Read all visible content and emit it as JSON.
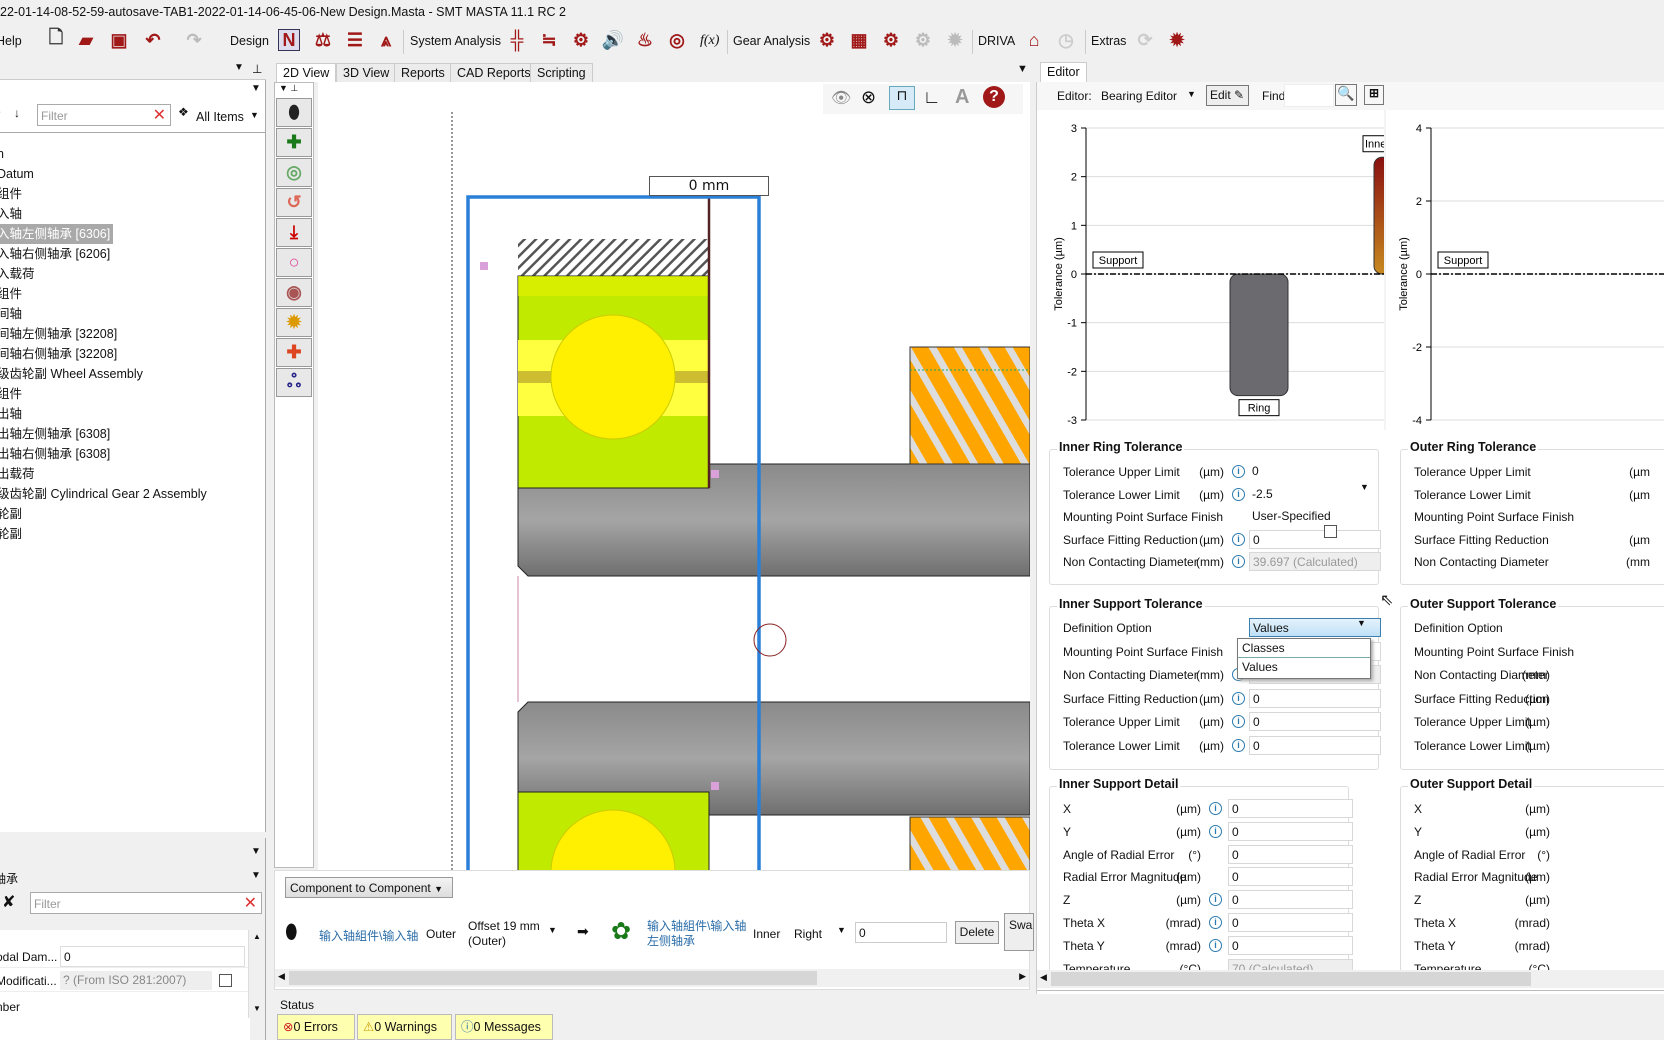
{
  "window": {
    "title": "22-01-14-08-52-59-autosave-TAB1-2022-01-14-06-45-06-New Design.Masta - SMT MASTA 11.1 RC 2"
  },
  "toolbar": {
    "help": "Help",
    "design": "Design",
    "system_analysis": "System Analysis",
    "fx": "f(x)",
    "gear_analysis": "Gear Analysis",
    "driva": "DRIVA",
    "extras": "Extras",
    "accent": "#a01818"
  },
  "tree_panel": {
    "filter_placeholder": "Filter",
    "all_items": "All Items",
    "items": [
      {
        "label": "n"
      },
      {
        "label": " Datum"
      },
      {
        "label": "组件"
      },
      {
        "label": "入轴"
      },
      {
        "label": "入轴左侧轴承 [6306]",
        "selected": true
      },
      {
        "label": "入轴右侧轴承 [6206]"
      },
      {
        "label": "入载荷"
      },
      {
        "label": "组件"
      },
      {
        "label": "间轴"
      },
      {
        "label": "间轴左侧轴承 [32208]"
      },
      {
        "label": "间轴右侧轴承 [32208]"
      },
      {
        "label": "级齿轮副 Wheel Assembly"
      },
      {
        "label": "组件"
      },
      {
        "label": "出轴"
      },
      {
        "label": "出轴左侧轴承 [6308]"
      },
      {
        "label": "出轴右侧轴承 [6308]"
      },
      {
        "label": "出载荷"
      },
      {
        "label": "级齿轮副 Cylindrical Gear 2 Assembly"
      },
      {
        "label": "轮副"
      },
      {
        "label": "轮副"
      }
    ]
  },
  "property_panel": {
    "selector": "轴承",
    "filter_placeholder": "Filter",
    "rows": [
      {
        "label": "odal Dam...",
        "value": "0"
      },
      {
        "label": "Modificati...",
        "value": "? (From ISO 281:2007)"
      },
      {
        "label": "nber",
        "value": ""
      }
    ]
  },
  "view_tabs": [
    "2D View",
    "3D View",
    "Reports",
    "CAD Reports",
    "Scripting"
  ],
  "view": {
    "dimension_label": "0 mm"
  },
  "connection": {
    "mode": "Component to Component",
    "from": "输入轴組件\\输入轴",
    "from_side": "Outer",
    "offset": "Offset 19 mm",
    "offset_sub": "(Outer)",
    "to": "输入轴組件\\输入轴左侧轴承",
    "to_side": "Inner",
    "position": "Right",
    "value": "0",
    "delete": "Delete",
    "swap": "Swap"
  },
  "status": {
    "title": "Status",
    "errors": "0 Errors",
    "warnings": "0 Warnings",
    "messages": "0 Messages"
  },
  "editor": {
    "tab": "Editor",
    "label": "Editor:",
    "editor_type": "Bearing Editor",
    "edit": "Edit",
    "find": "Find",
    "find_value": ""
  },
  "chart_data": [
    {
      "type": "bar",
      "ylabel": "Tolerance (µm)",
      "ylim": [
        -3,
        3
      ],
      "yticks": [
        -3,
        -2,
        -1,
        0,
        1,
        2,
        3
      ],
      "grid": true,
      "annotations": [
        "Support",
        "Ring",
        "Inner"
      ],
      "series": [
        {
          "name": "Ring",
          "values": [
            [
              -2.5,
              0
            ]
          ],
          "color": "#6b6a6e"
        },
        {
          "name": "Inner",
          "values": [
            [
              0,
              2.4
            ]
          ],
          "color": "#b03010"
        }
      ]
    },
    {
      "type": "bar",
      "ylabel": "Tolerance (µm)",
      "ylim": [
        -4,
        4
      ],
      "yticks": [
        -4,
        -2,
        0,
        2,
        4
      ],
      "grid": true,
      "annotations": [
        "Support"
      ],
      "series": []
    }
  ],
  "inner_ring_tolerance": {
    "title": "Inner Ring Tolerance",
    "rows": [
      {
        "label": "Tolerance Upper Limit",
        "unit": "(µm)",
        "value": "0"
      },
      {
        "label": "Tolerance Lower Limit",
        "unit": "(µm)",
        "value": "-2.5"
      },
      {
        "label": "Mounting Point Surface Finish",
        "unit": "",
        "value": "User-Specified"
      },
      {
        "label": "Surface Fitting Reduction",
        "unit": "(µm)",
        "value": "0"
      },
      {
        "label": "Non Contacting Diameter",
        "unit": "(mm)",
        "value": "39.697 (Calculated)"
      }
    ]
  },
  "outer_ring_tolerance": {
    "title": "Outer Ring Tolerance",
    "rows": [
      {
        "label": "Tolerance Upper Limit",
        "unit": "(µm"
      },
      {
        "label": "Tolerance Lower Limit",
        "unit": "(µm"
      },
      {
        "label": "Mounting Point Surface Finish",
        "unit": ""
      },
      {
        "label": "Surface Fitting Reduction",
        "unit": "(µm"
      },
      {
        "label": "Non Contacting Diameter",
        "unit": "(mm"
      }
    ]
  },
  "inner_support_tolerance": {
    "title": "Inner Support Tolerance",
    "rows": [
      {
        "label": "Definition Option",
        "unit": "",
        "value": "Values"
      },
      {
        "label": "Mounting Point Surface Finish",
        "unit": "",
        "value": ""
      },
      {
        "label": "Non Contacting Diameter",
        "unit": "(mm)",
        "value": ""
      },
      {
        "label": "Surface Fitting Reduction",
        "unit": "(µm)",
        "value": "0"
      },
      {
        "label": "Tolerance Upper Limit",
        "unit": "(µm)",
        "value": "0"
      },
      {
        "label": "Tolerance Lower Limit",
        "unit": "(µm)",
        "value": "0"
      }
    ],
    "dropdown_options": [
      "Classes",
      "Values"
    ]
  },
  "outer_support_tolerance": {
    "title": "Outer Support Tolerance",
    "rows": [
      {
        "label": "Definition Option",
        "unit": ""
      },
      {
        "label": "Mounting Point Surface Finish",
        "unit": ""
      },
      {
        "label": "Non Contacting Diameter",
        "unit": "(mm)"
      },
      {
        "label": "Surface Fitting Reduction",
        "unit": "(µm)"
      },
      {
        "label": "Tolerance Upper Limit",
        "unit": "(µm)"
      },
      {
        "label": "Tolerance Lower Limit",
        "unit": "(µm)"
      }
    ]
  },
  "inner_support_detail": {
    "title": "Inner Support Detail",
    "rows": [
      {
        "label": "X",
        "unit": "(µm)",
        "value": "0",
        "info": true
      },
      {
        "label": "Y",
        "unit": "(µm)",
        "value": "0",
        "info": true
      },
      {
        "label": "Angle of Radial Error",
        "unit": "(°)",
        "value": "0",
        "info": false
      },
      {
        "label": "Radial Error Magnitude",
        "unit": "(µm)",
        "value": "0",
        "info": false
      },
      {
        "label": "Z",
        "unit": "(µm)",
        "value": "0",
        "info": true
      },
      {
        "label": "Theta X",
        "unit": "(mrad)",
        "value": "0",
        "info": true
      },
      {
        "label": "Theta Y",
        "unit": "(mrad)",
        "value": "0",
        "info": true
      },
      {
        "label": "Temperature",
        "unit": "(°C)",
        "value": "70 (Calculated)",
        "info": false
      }
    ]
  },
  "outer_support_detail": {
    "title": "Outer Support Detail",
    "rows": [
      {
        "label": "X",
        "unit": "(µm)"
      },
      {
        "label": "Y",
        "unit": "(µm)"
      },
      {
        "label": "Angle of Radial Error",
        "unit": "(°)"
      },
      {
        "label": "Radial Error Magnitude",
        "unit": "(µm)"
      },
      {
        "label": "Z",
        "unit": "(µm)"
      },
      {
        "label": "Theta X",
        "unit": "(mrad)"
      },
      {
        "label": "Theta Y",
        "unit": "(mrad)"
      },
      {
        "label": "Temperature",
        "unit": "(°C)"
      }
    ]
  }
}
